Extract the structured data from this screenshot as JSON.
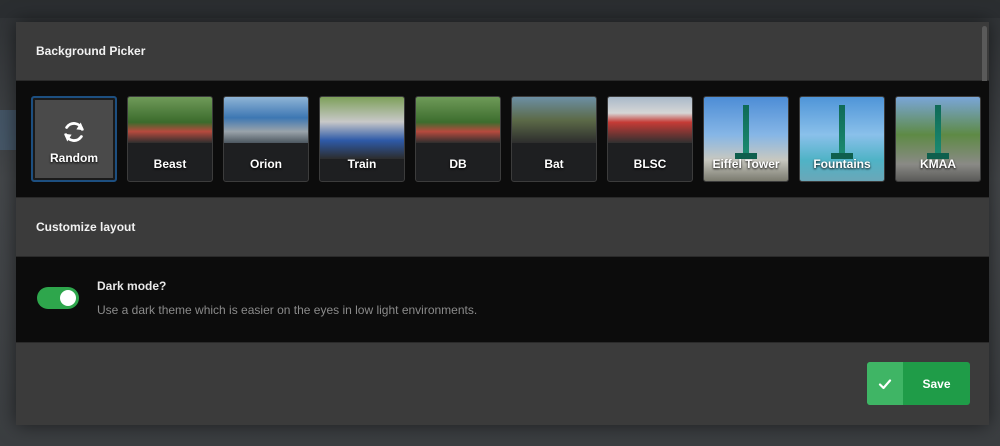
{
  "background_picker": {
    "title": "Background Picker",
    "tiles": [
      {
        "label": "Random",
        "icon": "refresh-icon",
        "selected": true
      },
      {
        "label": "Beast"
      },
      {
        "label": "Orion"
      },
      {
        "label": "Train"
      },
      {
        "label": "DB"
      },
      {
        "label": "Bat"
      },
      {
        "label": "BLSC"
      },
      {
        "label": "Eiffel Tower"
      },
      {
        "label": "Fountains"
      },
      {
        "label": "KMAA"
      }
    ]
  },
  "customize_layout": {
    "title": "Customize layout",
    "dark_mode": {
      "title": "Dark mode?",
      "description": "Use a dark theme which is easier on the eyes in low light environments.",
      "enabled": true
    }
  },
  "footer": {
    "save_label": "Save",
    "save_icon": "check-icon"
  },
  "colors": {
    "accent_green": "#1f9c48",
    "toggle_on": "#2ea64c",
    "selected_border": "#1d4f80"
  }
}
